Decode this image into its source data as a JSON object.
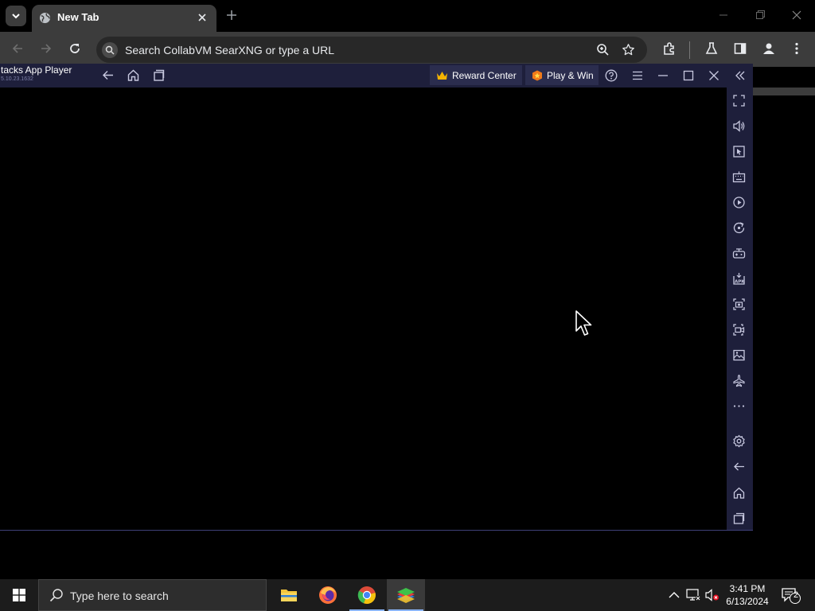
{
  "browser": {
    "tab_title": "New Tab",
    "omnibox_placeholder": "Search CollabVM SearXNG or type a URL"
  },
  "bluestacks": {
    "title": "tacks App Player",
    "version": "5.10.23.1632",
    "reward_label": "Reward Center",
    "playwin_label": "Play & Win",
    "sidebar_icons": [
      "fullscreen-icon",
      "volume-icon",
      "macro-pointer-icon",
      "keyboard-icon",
      "record-icon",
      "rotate-icon",
      "gamepad-icon",
      "apk-icon",
      "screenshot-icon",
      "screen-record-icon",
      "media-folder-icon",
      "airplane-icon",
      "more-icon",
      "settings-icon",
      "back-icon",
      "home-icon",
      "recent-apps-icon"
    ]
  },
  "taskbar": {
    "search_placeholder": "Type here to search",
    "time": "3:41 PM",
    "date": "6/13/2024",
    "notification_count": "2"
  },
  "colors": {
    "chrome_bg": "#3c3c3c",
    "bluestacks_titlebar": "#1e1f3b",
    "taskbar": "#1c1c1c",
    "accent": "#8ab4f8"
  }
}
